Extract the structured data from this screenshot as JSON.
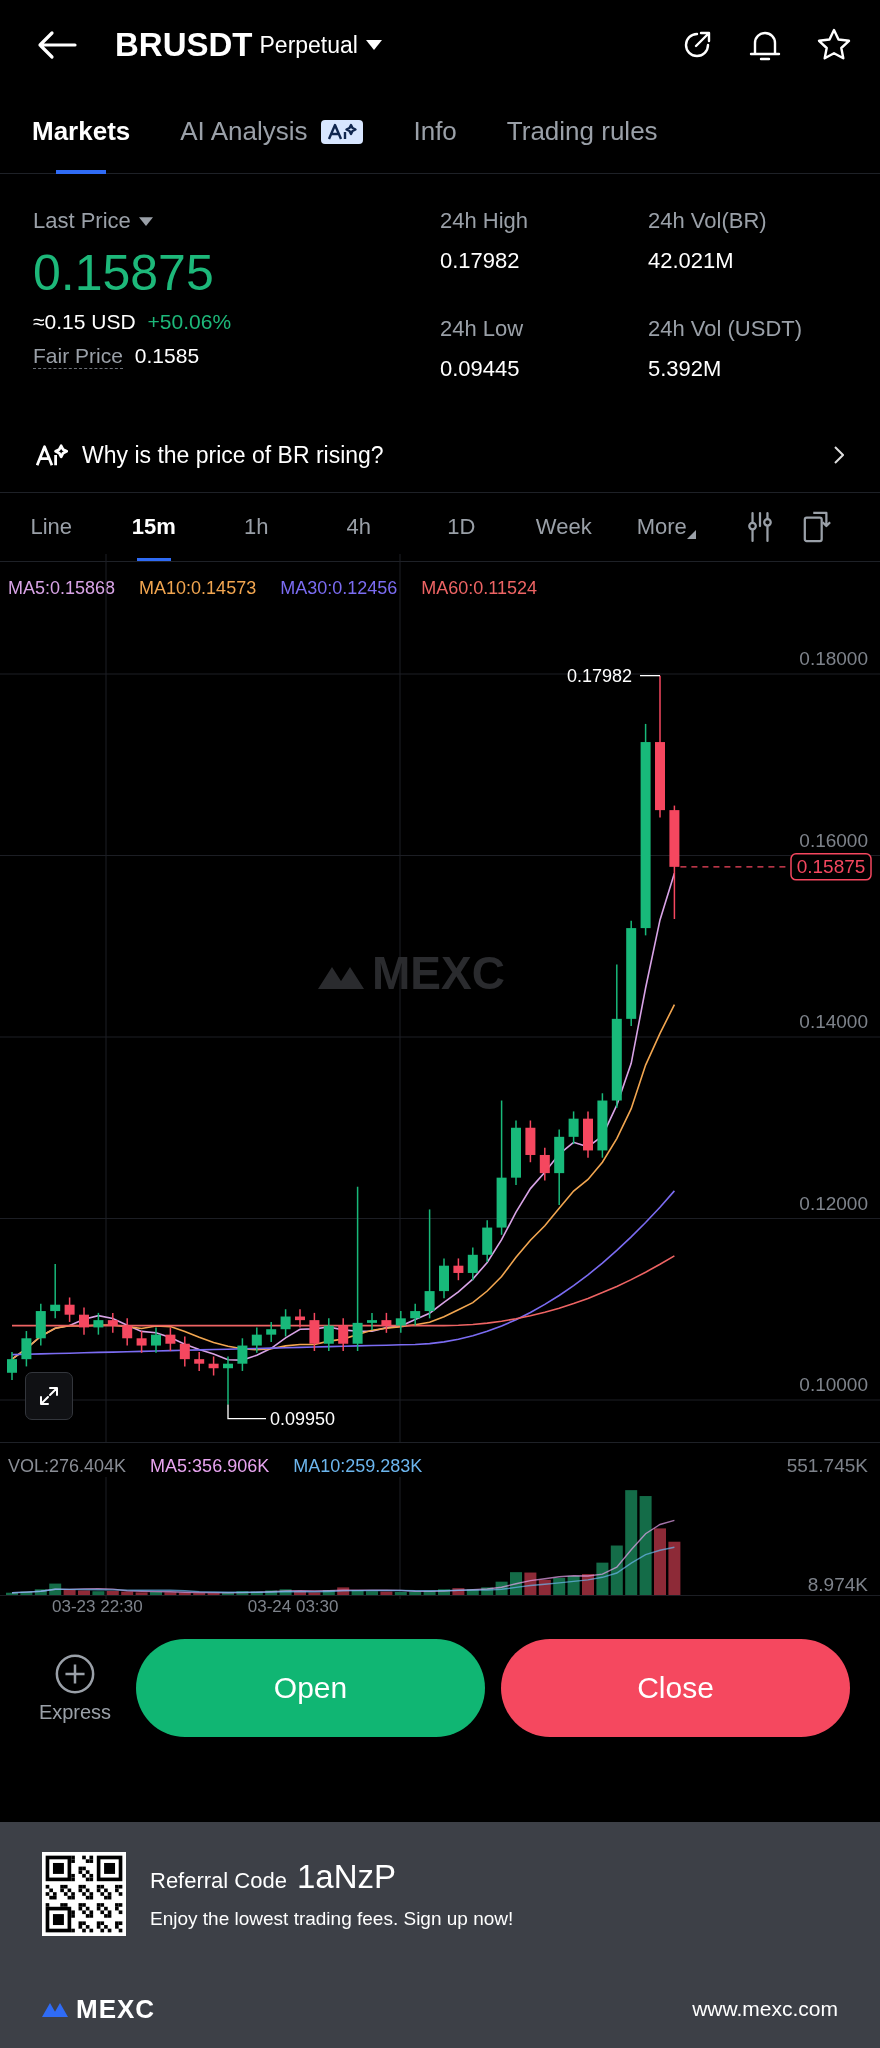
{
  "header": {
    "symbol": "BRUSDT",
    "contract_type": "Perpetual"
  },
  "tabs": [
    {
      "label": "Markets",
      "selected": true,
      "ai_badge": false
    },
    {
      "label": "AI Analysis",
      "selected": false,
      "ai_badge": true
    },
    {
      "label": "Info",
      "selected": false,
      "ai_badge": false
    },
    {
      "label": "Trading rules",
      "selected": false,
      "ai_badge": false
    }
  ],
  "market": {
    "last_price_label": "Last Price",
    "last_price": "0.15875",
    "usd_value": "≈0.15 USD",
    "change": "+50.06%",
    "fair_price_label": "Fair Price",
    "fair_price": "0.1585",
    "stats": [
      {
        "label": "24h High",
        "value": "0.17982"
      },
      {
        "label": "24h Vol(BR)",
        "value": "42.021M"
      },
      {
        "label": "24h Low",
        "value": "0.09445"
      },
      {
        "label": "24h Vol (USDT)",
        "value": "5.392M"
      }
    ]
  },
  "insight": "Why is the price of BR rising?",
  "intervals": [
    {
      "label": "Line",
      "selected": false
    },
    {
      "label": "15m",
      "selected": true
    },
    {
      "label": "1h",
      "selected": false
    },
    {
      "label": "4h",
      "selected": false
    },
    {
      "label": "1D",
      "selected": false
    },
    {
      "label": "Week",
      "selected": false
    },
    {
      "label": "More",
      "selected": false
    }
  ],
  "chart": {
    "ma_legend": [
      {
        "label": "MA5:0.15868",
        "color": "#d8a3e6"
      },
      {
        "label": "MA10:0.14573",
        "color": "#f2a650"
      },
      {
        "label": "MA30:0.12456",
        "color": "#7b6cf2"
      },
      {
        "label": "MA60:0.11524",
        "color": "#ee6464"
      }
    ],
    "price_ticks": [
      "0.18000",
      "0.16000",
      "0.14000",
      "0.12000",
      "0.10000"
    ],
    "high_label": "0.17982",
    "low_label": "0.09950",
    "current_price": "0.15875",
    "watermark": "MEXC",
    "volume_legend": [
      {
        "label": "VOL:276.404K",
        "color": "#8a8e96"
      },
      {
        "label": "MA5:356.906K",
        "color": "#e8a4f0"
      },
      {
        "label": "MA10:259.283K",
        "color": "#6cb6ee"
      }
    ],
    "volume_ticks": [
      "551.745K",
      "8.974K"
    ],
    "time_labels": [
      "03-23 22:30",
      "03-24 03:30"
    ]
  },
  "actions": {
    "express": "Express",
    "open": "Open",
    "close": "Close"
  },
  "footer": {
    "referral_label": "Referral Code",
    "referral_code": "1aNzP",
    "tagline": "Enjoy the lowest trading fees. Sign up now!",
    "brand": "MEXC",
    "website": "www.mexc.com"
  }
}
